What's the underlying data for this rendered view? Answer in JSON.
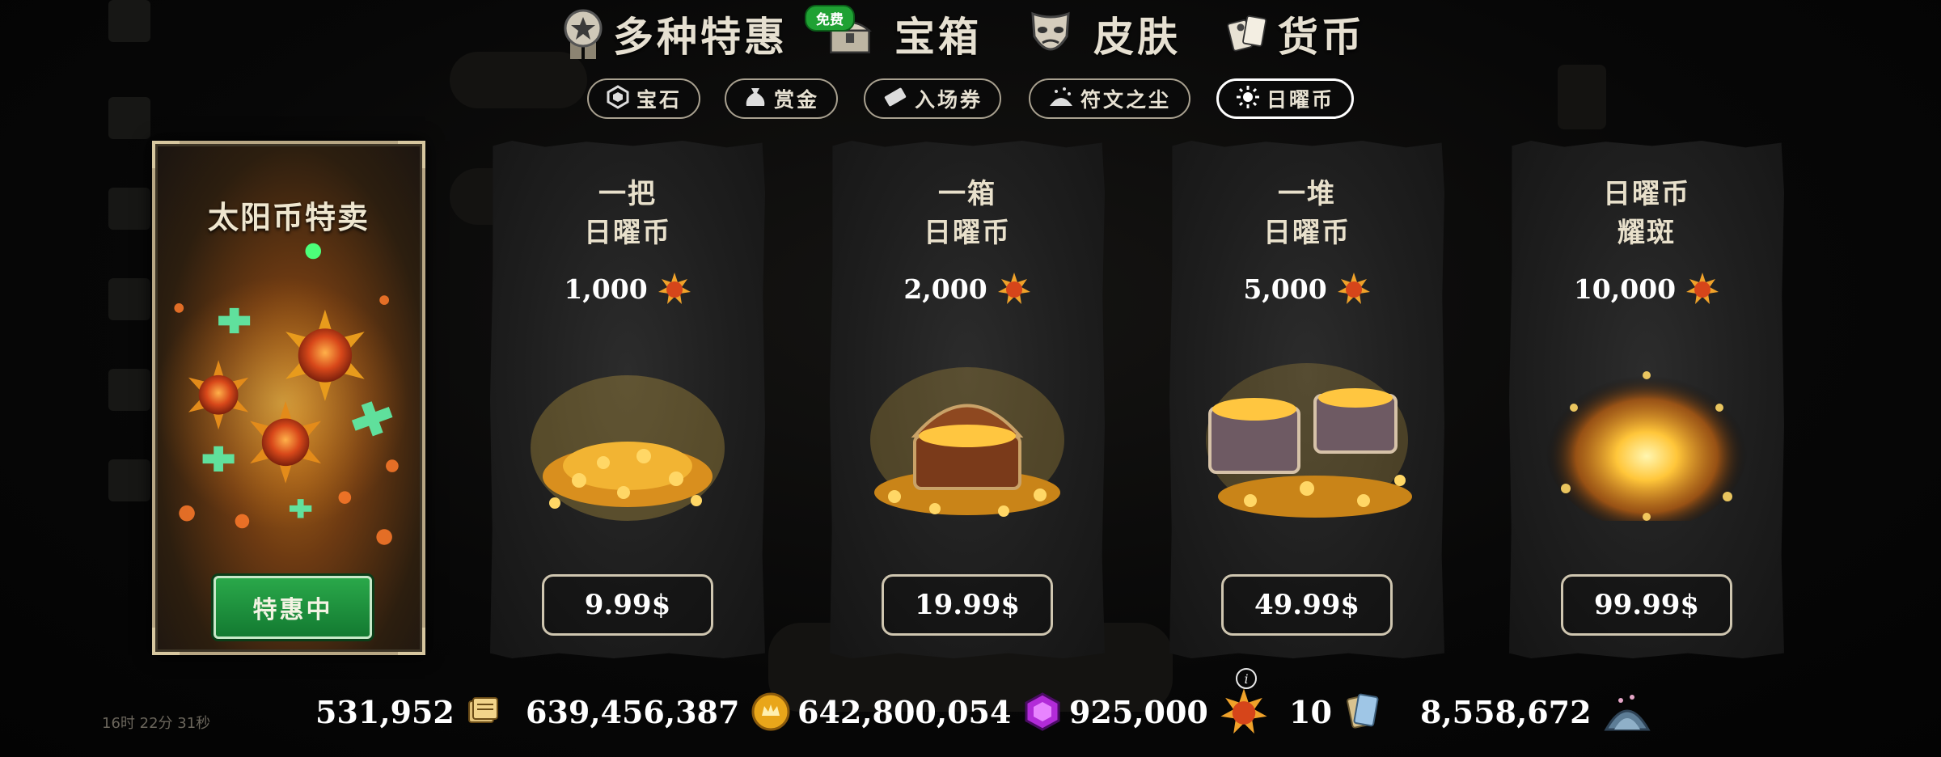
{
  "top_tabs": [
    {
      "label": "多种特惠",
      "icon": "medal-star-icon"
    },
    {
      "label": "宝箱",
      "icon": "treasure-chest-icon",
      "badge": "免费"
    },
    {
      "label": "皮肤",
      "icon": "theater-mask-icon"
    },
    {
      "label": "货币",
      "icon": "currency-cards-icon"
    }
  ],
  "sub_tabs": [
    {
      "label": "宝石",
      "icon": "gem-icon",
      "active": false
    },
    {
      "label": "赏金",
      "icon": "bounty-bag-icon",
      "active": false
    },
    {
      "label": "入场券",
      "icon": "ticket-icon",
      "active": false
    },
    {
      "label": "符文之尘",
      "icon": "rune-dust-icon",
      "active": false
    },
    {
      "label": "日曜币",
      "icon": "sun-icon",
      "active": true
    }
  ],
  "featured": {
    "title": "太阳币特卖",
    "button": "特惠中"
  },
  "offers": [
    {
      "name_line1": "一把",
      "name_line2": "日曜币",
      "amount": "1,000",
      "price": "9.99$"
    },
    {
      "name_line1": "一箱",
      "name_line2": "日曜币",
      "amount": "2,000",
      "price": "19.99$"
    },
    {
      "name_line1": "一堆",
      "name_line2": "日曜币",
      "amount": "5,000",
      "price": "49.99$"
    },
    {
      "name_line1": "日曜币",
      "name_line2": "耀斑",
      "amount": "10,000",
      "price": "99.99$"
    }
  ],
  "currencies": [
    {
      "value": "531,952",
      "icon": "ticket-stack-icon"
    },
    {
      "value": "639,456,387",
      "icon": "gold-coin-icon"
    },
    {
      "value": "642,800,054",
      "icon": "purple-gem-icon"
    },
    {
      "value": "925,000",
      "icon": "sun-coin-icon"
    },
    {
      "value": "10",
      "icon": "rune-card-icon"
    },
    {
      "value": "8,558,672",
      "icon": "rune-dust-pile-icon"
    }
  ],
  "background": {
    "timer": "16时 22分 31秒"
  },
  "colors": {
    "active_button_green": "#1f9540",
    "sun_coin_orange": "#e8691a",
    "free_badge_green": "#1fa133"
  }
}
